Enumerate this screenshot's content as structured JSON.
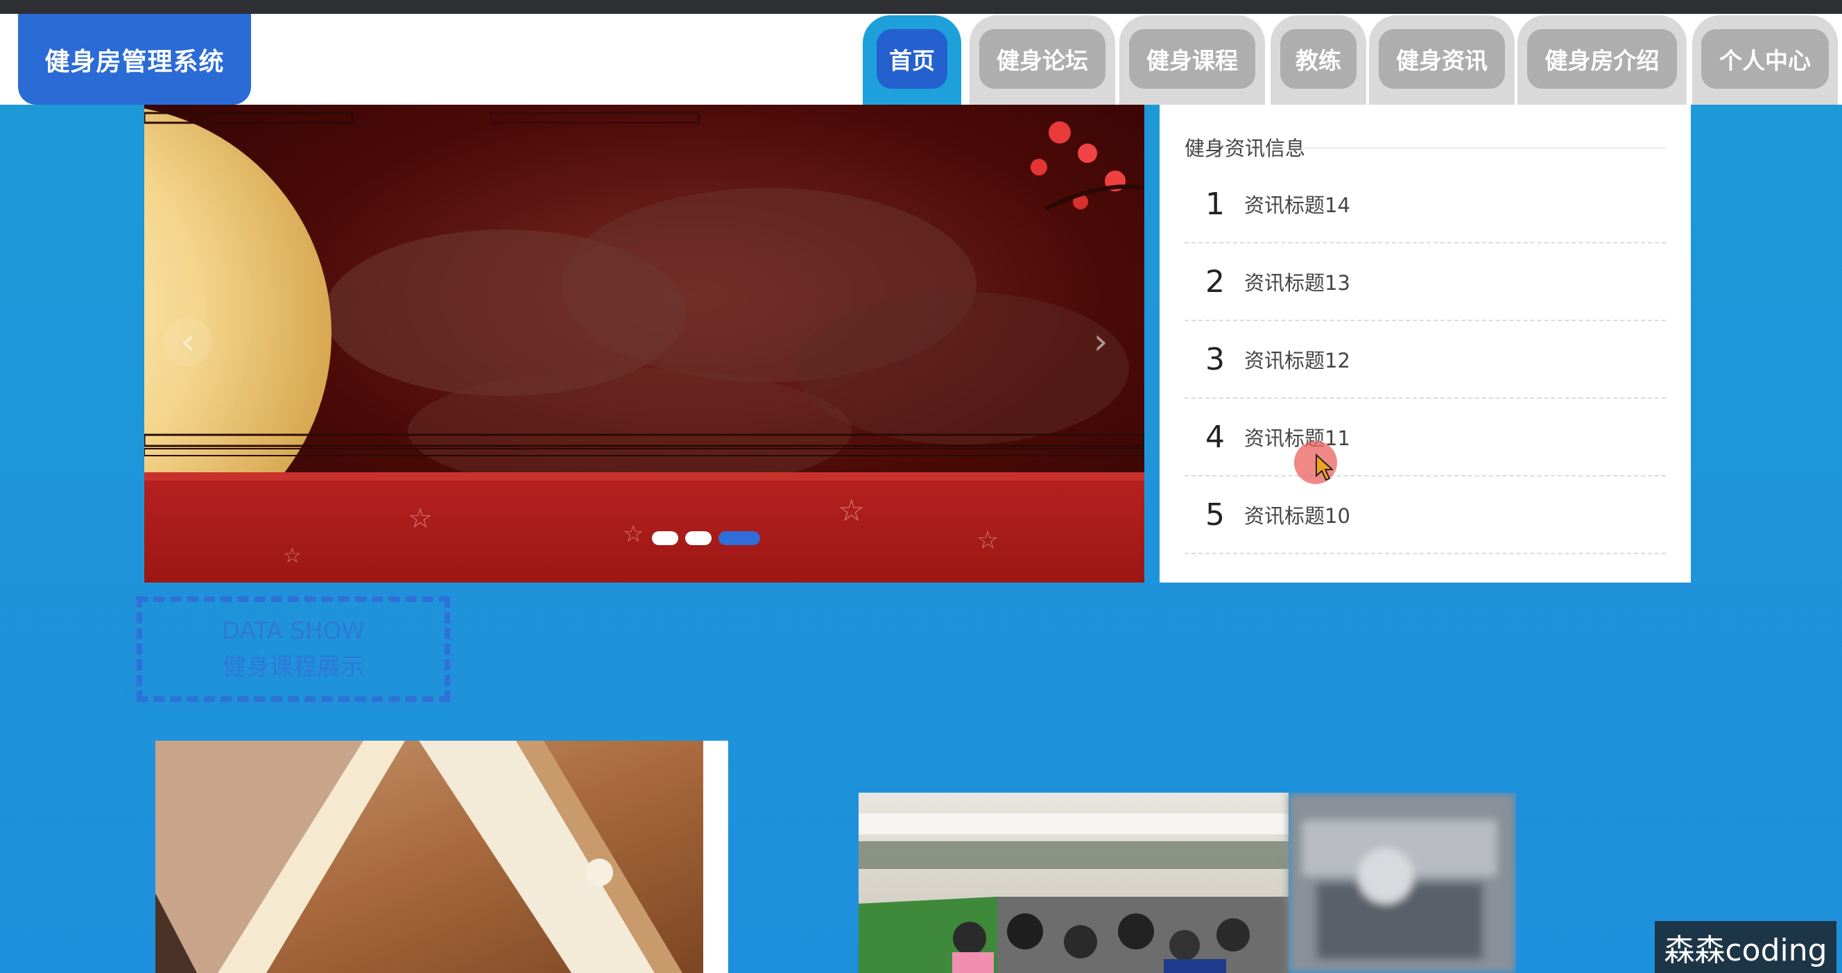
{
  "app": {
    "title": "健身房管理系统"
  },
  "nav": {
    "items": [
      {
        "label": "首页",
        "active": true
      },
      {
        "label": "健身论坛",
        "active": false
      },
      {
        "label": "健身课程",
        "active": false
      },
      {
        "label": "教练",
        "active": false
      },
      {
        "label": "健身资讯",
        "active": false
      },
      {
        "label": "健身房介绍",
        "active": false
      },
      {
        "label": "个人中心",
        "active": false
      }
    ]
  },
  "carousel": {
    "prev_icon": "chevron-left-icon",
    "next_icon": "chevron-right-icon",
    "prev_glyph": "‹",
    "next_glyph": "›",
    "slide_count": 3,
    "active_slide": 3
  },
  "news": {
    "title": "健身资讯信息",
    "items": [
      {
        "num": "1",
        "text": "资讯标题14"
      },
      {
        "num": "2",
        "text": "资讯标题13"
      },
      {
        "num": "3",
        "text": "资讯标题12"
      },
      {
        "num": "4",
        "text": "资讯标题11"
      },
      {
        "num": "5",
        "text": "资讯标题10"
      }
    ]
  },
  "section": {
    "title_en": "DATA SHOW",
    "title_cn": "健身课程展示"
  },
  "watermark": {
    "text": "森森coding"
  },
  "colors": {
    "accent": "#2461cf",
    "background": "#1e9ad6",
    "nav_inactive": "#aeaeae"
  }
}
